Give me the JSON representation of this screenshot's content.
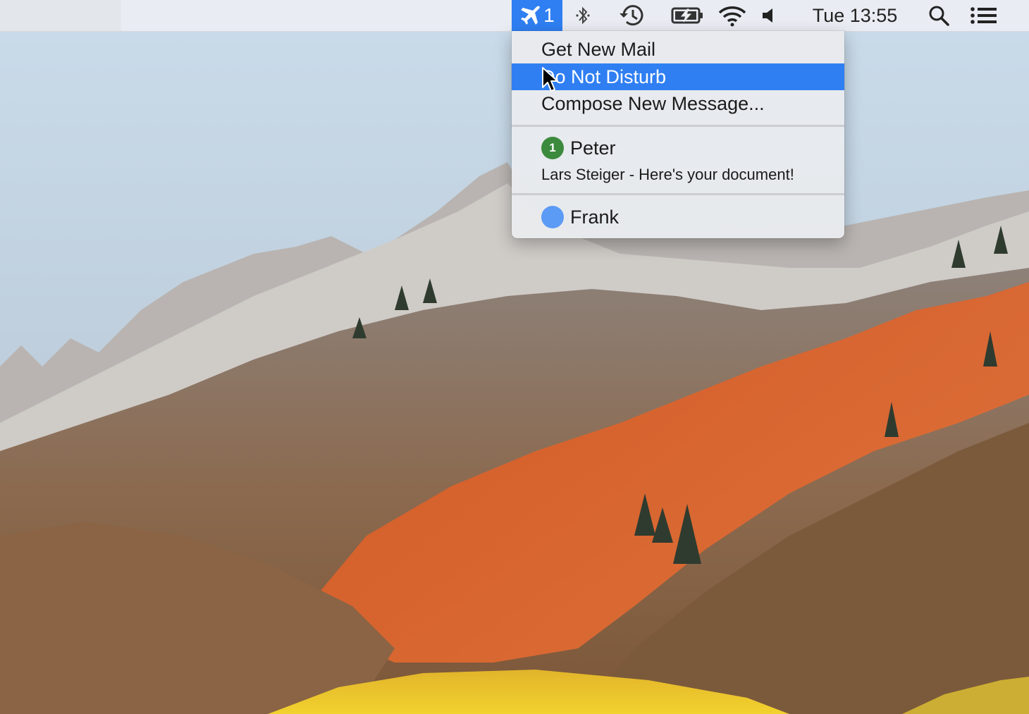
{
  "menubar": {
    "mail_status": {
      "icon": "airplane-icon",
      "count": "1",
      "highlight_color": "#2F7FF2"
    },
    "icons": [
      "bluetooth-icon",
      "time-machine-icon",
      "battery-charging-icon",
      "wifi-icon",
      "volume-icon"
    ],
    "clock": "Tue 13:55",
    "right_icons": [
      "spotlight-search-icon",
      "notification-center-icon"
    ]
  },
  "dropdown": {
    "items": [
      {
        "label": "Get New Mail"
      },
      {
        "label": "Do Not Disturb",
        "highlighted": true
      },
      {
        "label": "Compose New Message..."
      }
    ],
    "contacts": [
      {
        "name": "Peter",
        "unread": "1",
        "badge_color": "#3C8A3E",
        "preview": "Lars Steiger - Here's your document!"
      },
      {
        "name": "Frank",
        "badge_color": "#5B9BF5"
      }
    ]
  }
}
